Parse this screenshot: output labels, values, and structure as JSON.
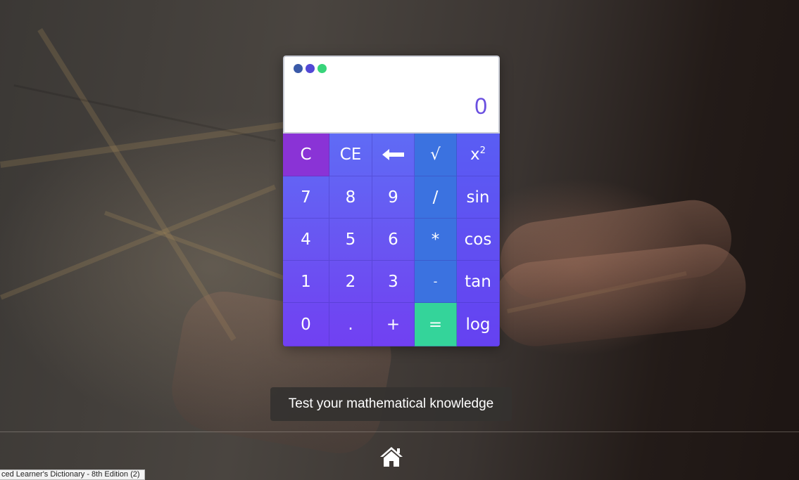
{
  "window": {
    "dot_colors": [
      "#3a5aa8",
      "#5248d6",
      "#38d47a"
    ]
  },
  "calculator": {
    "display_value": "0",
    "colors": {
      "display_text": "#6a4fe0",
      "clear_key": "#8a33d6",
      "operator_column": "#3b72e0",
      "equals_key": "#34d49a",
      "key_gradient_top": "#5f6bf5",
      "key_gradient_bottom": "#7140f2"
    },
    "keys": {
      "clear": "C",
      "clear_entry": "CE",
      "backspace": "⟵",
      "sqrt": "√",
      "square_base": "x",
      "square_exp": "2",
      "seven": "7",
      "eight": "8",
      "nine": "9",
      "divide": "/",
      "sin": "sin",
      "four": "4",
      "five": "5",
      "six": "6",
      "multiply": "*",
      "cos": "cos",
      "one": "1",
      "two": "2",
      "three": "3",
      "minus": "-",
      "tan": "tan",
      "zero": "0",
      "dot": ".",
      "plus": "+",
      "equals": "=",
      "log": "log"
    }
  },
  "tooltip": "Test your mathematical knowledge",
  "footer": {
    "home_icon": "home-icon"
  },
  "statusbar": {
    "text": "ced Learner's Dictionary - 8th Edition (2)"
  }
}
